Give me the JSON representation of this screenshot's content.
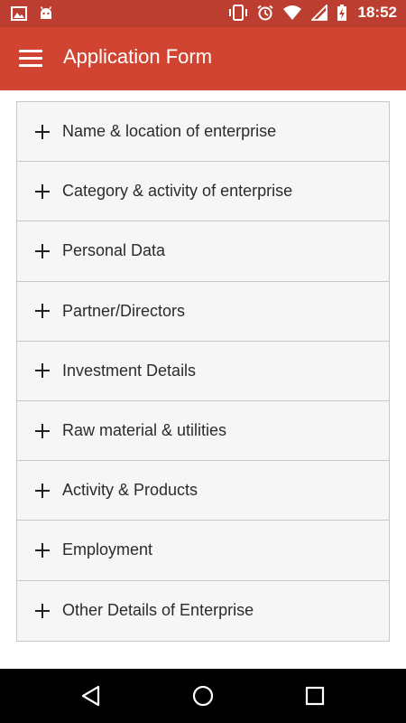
{
  "status_bar": {
    "time": "18:52",
    "icons_left": [
      "image-icon",
      "android-icon"
    ],
    "icons_right": [
      "vibrate-icon",
      "alarm-icon",
      "wifi-icon",
      "signal-icon",
      "battery-icon"
    ]
  },
  "app_bar": {
    "title": "Application Form",
    "menu_icon": "hamburger-menu-icon"
  },
  "sections": [
    {
      "label": "Name & location of enterprise"
    },
    {
      "label": "Category & activity of enterprise"
    },
    {
      "label": "Personal Data"
    },
    {
      "label": "Partner/Directors"
    },
    {
      "label": "Investment Details"
    },
    {
      "label": "Raw material & utilities"
    },
    {
      "label": "Activity & Products"
    },
    {
      "label": "Employment"
    },
    {
      "label": "Other Details of Enterprise"
    }
  ],
  "nav_bar": {
    "buttons": [
      "back-icon",
      "home-icon",
      "recents-icon"
    ]
  },
  "colors": {
    "status_bar": "#bb3e30",
    "app_bar": "#d24432",
    "accordion_bg": "#f6f6f6",
    "border": "#c8c8c8"
  }
}
